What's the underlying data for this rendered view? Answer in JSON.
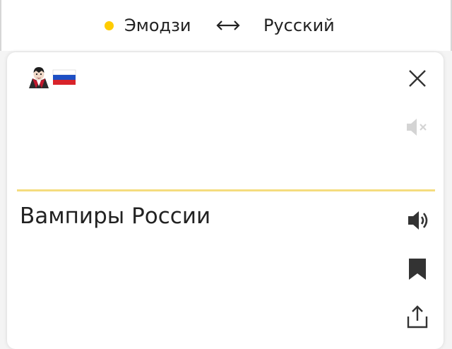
{
  "lang_bar": {
    "source_lang": "Эмодзи",
    "target_lang": "Русский",
    "accent_color": "#ffcc00"
  },
  "input": {
    "text": "🧛🇷🇺",
    "icons": [
      "vampire-icon",
      "russia-flag-icon"
    ]
  },
  "output": {
    "text": "Вампиры России"
  },
  "icons": {
    "clear": "close-icon",
    "input_audio": "speaker-muted-icon",
    "output_audio": "speaker-icon",
    "bookmark": "bookmark-icon",
    "share": "share-icon"
  },
  "colors": {
    "divider": "#f5dc7e",
    "icon": "#333333",
    "icon_disabled": "#d4d4d4"
  }
}
